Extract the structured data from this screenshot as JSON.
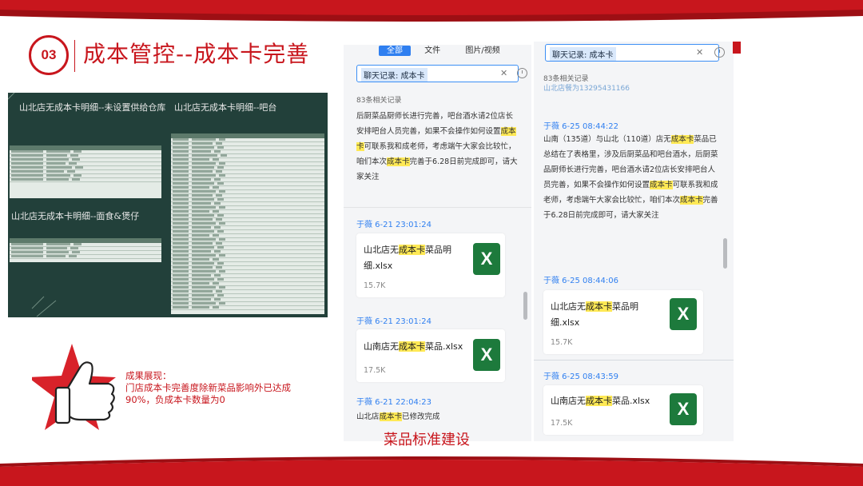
{
  "colors": {
    "brand_red": "#c8161d",
    "highlight": "#ffe955",
    "chat_blue": "#2f7ff0",
    "excel_green": "#1d7a3c",
    "sheet_bg": "#22403a"
  },
  "title": {
    "number": "03",
    "text": "成本管控--成本卡完善"
  },
  "sheet": {
    "heading_left": "山北店无成本卡明细--未设置供给仓库",
    "heading_right": "山北店无成本卡明细--吧台",
    "heading_bottom": "山北店无成本卡明细--面食&煲仔"
  },
  "result": {
    "label": "成果展现：",
    "body": "门店成本卡完善度除新菜品影响外已达成90%，负成本卡数量为0"
  },
  "caption": "菜品标准建设",
  "thumbs_icon": "thumbs-up-icon",
  "chat_left": {
    "tabs": [
      "全部",
      "文件",
      "图片/视频"
    ],
    "search_value": "聊天记录: 成本卡",
    "count": "83条相关记录",
    "message_pre": "后厨菜品厨师长进行完善，吧台酒水请2位店长安排吧台人员完善，如果不会操作如何设置",
    "message_hl1": "成本卡",
    "message_mid": "可联系我和成老师，考虑端午大家会比较忙，咱们本次",
    "message_hl2": "成本卡",
    "message_post": "完善于6.28日前完成即可，请大家关注",
    "items": [
      {
        "sender": "于薇 6-21 23:01:24",
        "file_pre": "山北店无",
        "file_hl": "成本卡",
        "file_post": "菜品明细.xlsx",
        "size": "15.7K",
        "icon": "excel-icon"
      },
      {
        "sender": "于薇 6-21 23:01:24",
        "file_pre": "山南店无",
        "file_hl": "成本卡",
        "file_post": "菜品.xlsx",
        "size": "17.5K",
        "icon": "excel-icon"
      }
    ],
    "last_sender": "于薇 6-21 22:04:23",
    "last_pre": "山北店",
    "last_hl": "成本卡",
    "last_post": "已修改完成"
  },
  "chat_right": {
    "search_value": "聊天记录: 成本卡",
    "count": "83条相关记录",
    "cut_text": "山北店餐为13295431166",
    "sender1": "于薇 6-25 08:44:22",
    "message_pre": "山南（135道）与山北（110道）店无",
    "message_hl1": "成本卡",
    "message_mid1": "菜品已总结在了表格里，涉及后厨菜品和吧台酒水，后厨菜品厨师长进行完善，吧台酒水请2位店长安排吧台人员完善，如果不会操作如何设置",
    "message_hl2": "成本卡",
    "message_mid2": "可联系我和成老师，考虑端午大家会比较忙，咱们本次",
    "message_hl3": "成本卡",
    "message_post": "完善于6.28日前完成即可，请大家关注",
    "items": [
      {
        "sender": "于薇 6-25 08:44:06",
        "file_pre": "山北店无",
        "file_hl": "成本卡",
        "file_post": "菜品明细.xlsx",
        "size": "15.7K",
        "icon": "excel-icon"
      },
      {
        "sender": "于薇 6-25 08:43:59",
        "file_pre": "山南店无",
        "file_hl": "成本卡",
        "file_post": "菜品.xlsx",
        "size": "17.5K",
        "icon": "excel-icon"
      }
    ]
  }
}
